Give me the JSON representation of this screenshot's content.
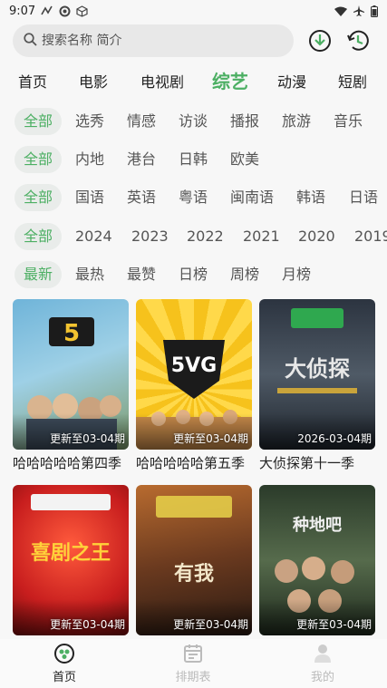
{
  "status": {
    "time": "9:07"
  },
  "search": {
    "placeholder": "搜索名称 简介"
  },
  "nav_tabs": [
    "首页",
    "电影",
    "电视剧",
    "综艺",
    "动漫",
    "短剧"
  ],
  "nav_active": "综艺",
  "filters": {
    "type": [
      "全部",
      "选秀",
      "情感",
      "访谈",
      "播报",
      "旅游",
      "音乐"
    ],
    "region": [
      "全部",
      "内地",
      "港台",
      "日韩",
      "欧美"
    ],
    "language": [
      "全部",
      "国语",
      "英语",
      "粤语",
      "闽南语",
      "韩语",
      "日语"
    ],
    "year": [
      "全部",
      "2024",
      "2023",
      "2022",
      "2021",
      "2020",
      "2019"
    ],
    "sort": [
      "最新",
      "最热",
      "最赞",
      "日榜",
      "周榜",
      "月榜"
    ]
  },
  "cards": [
    {
      "title": "哈哈哈哈哈第四季",
      "badge": "更新至03-04期",
      "poster_text": "5"
    },
    {
      "title": "哈哈哈哈哈第五季",
      "badge": "更新至03-04期",
      "poster_text": "5VG"
    },
    {
      "title": "大侦探第十一季",
      "badge": "2026-03-04期",
      "poster_text": "大侦探"
    },
    {
      "title": "",
      "badge": "更新至03-04期",
      "poster_text": "喜剧之王"
    },
    {
      "title": "",
      "badge": "更新至03-04期",
      "poster_text": "有我"
    },
    {
      "title": "",
      "badge": "更新至03-04期",
      "poster_text": "种地吧"
    }
  ],
  "bottom_nav": [
    "首页",
    "排期表",
    "我的"
  ],
  "colors": {
    "accent": "#4caf63",
    "background": "#f7f7f7"
  }
}
